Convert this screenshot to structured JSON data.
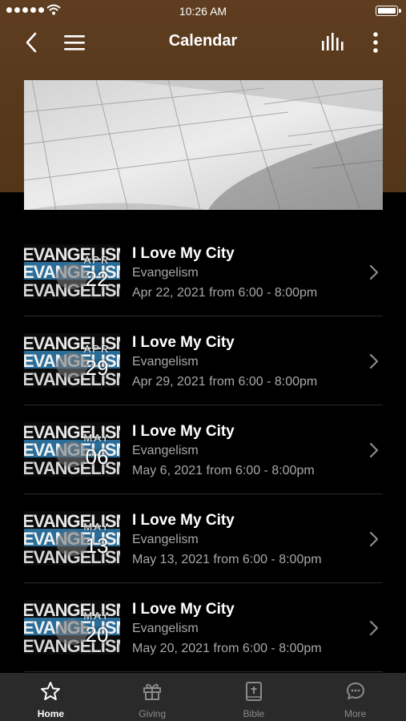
{
  "status_bar": {
    "time": "10:26 AM"
  },
  "nav": {
    "title": "Calendar"
  },
  "events": [
    {
      "title": "I Love My City",
      "category": "Evangelism",
      "date": "Apr 22, 2021 from 6:00 - 8:00pm",
      "month": "APR",
      "day": "22"
    },
    {
      "title": "I Love My City",
      "category": "Evangelism",
      "date": "Apr 29, 2021 from 6:00 - 8:00pm",
      "month": "APR",
      "day": "29"
    },
    {
      "title": "I Love My City",
      "category": "Evangelism",
      "date": "May 6, 2021 from 6:00 - 8:00pm",
      "month": "MAY",
      "day": "06"
    },
    {
      "title": "I Love My City",
      "category": "Evangelism",
      "date": "May 13, 2021 from 6:00 - 8:00pm",
      "month": "MAY",
      "day": "13"
    },
    {
      "title": "I Love My City",
      "category": "Evangelism",
      "date": "May 20, 2021 from 6:00 - 8:00pm",
      "month": "MAY",
      "day": "20"
    }
  ],
  "thumb_logo": "EVANGELISM",
  "tabs": [
    {
      "label": "Home",
      "icon": "star-icon",
      "active": true
    },
    {
      "label": "Giving",
      "icon": "gift-icon",
      "active": false
    },
    {
      "label": "Bible",
      "icon": "bible-icon",
      "active": false
    },
    {
      "label": "More",
      "icon": "chat-bubble-icon",
      "active": false
    }
  ],
  "colors": {
    "header_brown": "#5a3a1e",
    "background": "#000000",
    "tabbar": "#2a2a2a",
    "accent_blue": "#3f8fc0"
  }
}
